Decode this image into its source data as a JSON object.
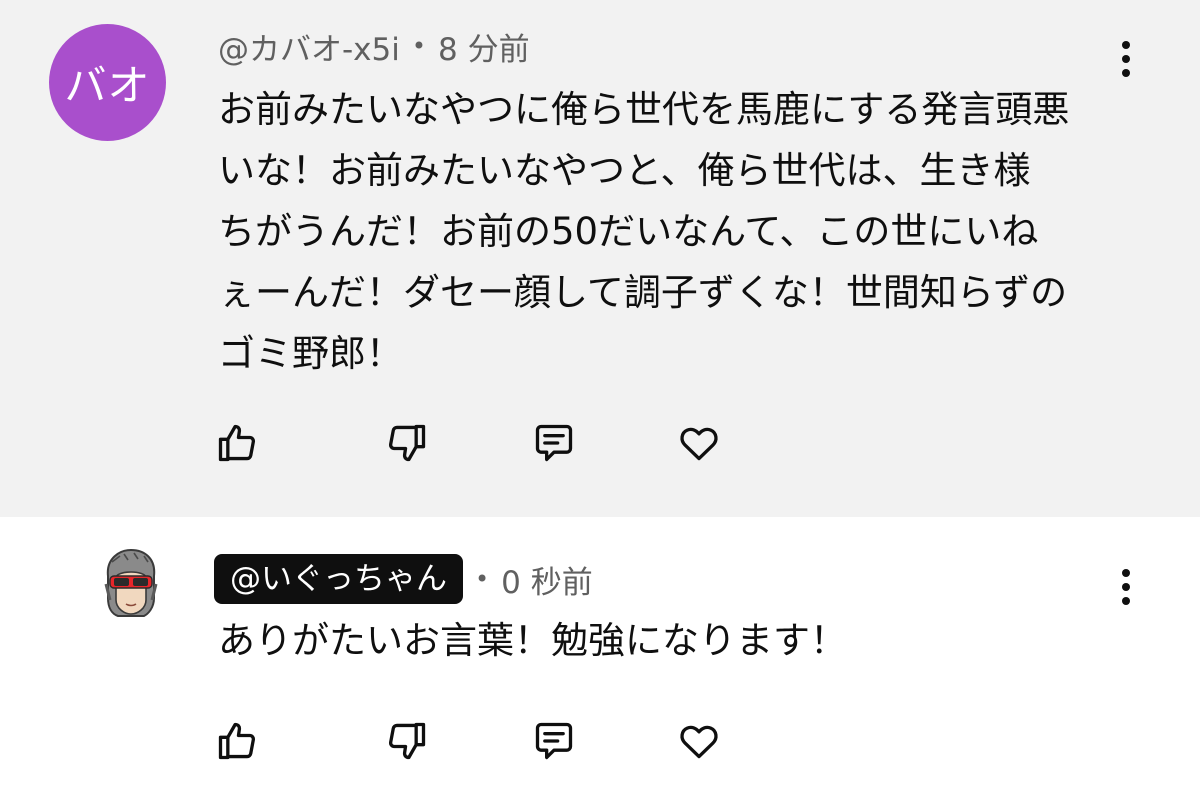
{
  "comments": [
    {
      "avatar_text": "バオ",
      "avatar_color": "#a94fcc",
      "handle": "@カバオ-x5i",
      "time": "8 分前",
      "lines": [
        "お前みたいなやつに俺ら世代を馬鹿にする発言頭悪",
        "いな！お前みたいなやつと、俺ら世代は、生き様",
        "ちがうんだ！お前の50だいなんて、この世にいね",
        "ぇーんだ！ダセー顔して調子ずくな！世間知らずの",
        "ゴミ野郎！"
      ],
      "background": "#f2f2f2"
    },
    {
      "avatar_icon": "avatar-icon",
      "handle": "@いぐっちゃん",
      "time": "0 秒前",
      "lines": [
        "ありがたいお言葉！勉強になります！"
      ],
      "background": "#ffffff"
    }
  ],
  "icons": {
    "like": "thumbs-up-icon",
    "dislike": "thumbs-down-icon",
    "reply": "reply-icon",
    "heart": "heart-icon",
    "menu": "more-vert-icon"
  }
}
